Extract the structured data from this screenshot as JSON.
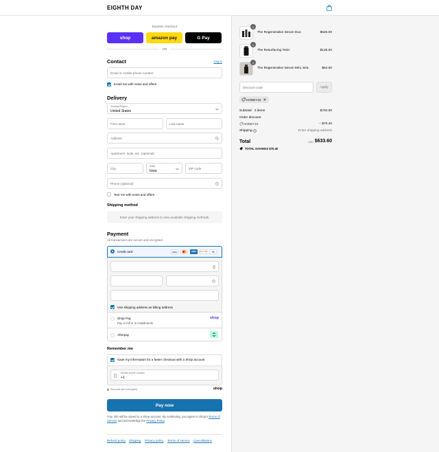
{
  "header": {
    "brand": "EIGHTH DAY",
    "cart_icon": "shopping-bag-icon"
  },
  "express": {
    "label": "Express checkout",
    "shop": "shop",
    "amazon": "amazon pay",
    "gpay": "G Pay",
    "or": "OR"
  },
  "contact": {
    "title": "Contact",
    "login": "Log in",
    "email_placeholder": "Email or mobile phone number",
    "news": "Email me with news and offers"
  },
  "delivery": {
    "title": "Delivery",
    "country_label": "Country/Region",
    "country": "United States",
    "first": "First name",
    "last": "Last name",
    "address": "Address",
    "apt": "Apartment, suite, etc. (optional)",
    "city": "City",
    "state_label": "State",
    "state": "Iowa",
    "zip": "ZIP code",
    "phone": "Phone (optional)",
    "text_news": "Text me with news and offers"
  },
  "shipping": {
    "title": "Shipping method",
    "msg": "Enter your shipping address to view available shipping methods."
  },
  "payment": {
    "title": "Payment",
    "subtitle": "All transactions are secure and encrypted.",
    "credit": "Credit card",
    "cards": [
      "VISA",
      "MC",
      "AMEX",
      "DISCOVER"
    ],
    "more": "+5",
    "billing": "Use shipping address as billing address",
    "shoppay": "Shop Pay",
    "shoppay_sub": "Pay in full or in installments",
    "shoppay_logo": "shop",
    "afterpay": "Afterpay"
  },
  "remember": {
    "title": "Remember me",
    "save": "Save my information for a faster checkout with a Shop account",
    "mobile_label": "Mobile phone number",
    "mobile_val": "+1",
    "secure": "Secured and encrypted",
    "shop": "shop"
  },
  "pay": {
    "button": "Pay now",
    "note1": "Your info will be saved to a Shop account. By continuing, you agree to Shop's",
    "terms": "Terms of Service",
    "note2": "and acknowledge the",
    "privacy": "Privacy Policy",
    "period": "."
  },
  "footer": [
    "Refund policy",
    "Shipping",
    "Privacy policy",
    "Terms of service",
    "Cancellations"
  ],
  "cart": {
    "items": [
      {
        "qty": "1",
        "name": "The Regenerative Serum Duo",
        "price": "$525.00"
      },
      {
        "qty": "1",
        "name": "The Resurfacing Tonic",
        "price": "$125.00"
      },
      {
        "qty": "1",
        "name": "The Regenerative Serum Mini, 5mL",
        "price": "$54.00"
      }
    ],
    "discount_placeholder": "Discount code",
    "apply": "Apply",
    "code": "HONEY10",
    "subtotal_label": "Subtotal · 3 items",
    "subtotal": "$704.00",
    "order_discount": "Order discount",
    "discount_code": "HONEY10",
    "discount_amount": "− $70.40",
    "shipping_label": "Shipping",
    "shipping_val": "Enter shipping address",
    "total_label": "Total",
    "currency": "USD",
    "total": "$633.60",
    "savings_label": "TOTAL SAVINGS",
    "savings": "$70.40"
  }
}
